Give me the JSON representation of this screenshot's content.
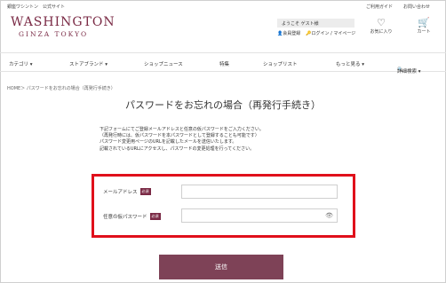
{
  "header": {
    "top_left": "銀座ワシントン　公式サイト",
    "top_links": [
      "ご利用ガイド",
      "お問い合わせ"
    ],
    "logo_line1": "WASHINGTON",
    "logo_line2": "GINZA TOKYO",
    "welcome": "ようこそ ゲスト様",
    "register": "会員登録",
    "login": "ログイン / マイページ",
    "favorite": "お気に入り",
    "cart": "カート"
  },
  "nav": {
    "items": [
      "カテゴリ ▾",
      "ストアブランド ▾",
      "ショップニュース",
      "特集",
      "ショップリスト",
      "もっと見る ▾",
      "詳細検索 ▾"
    ]
  },
  "breadcrumb": "HOME＞ パスワードをお忘れの場合（再発行手続き）",
  "page_title": "パスワードをお忘れの場合（再発行手続き）",
  "description": [
    "下記フォームにてご登録メールアドレスと任意の仮パスワードをご入力ください。",
    "（再発行時には、仮パスワードを本パスワードとして登録することも可能です）",
    "パスワード変更用ページのURLを記載したメールを送信いたします。",
    "記載されているURLにアクセスし、パスワードの変更処理を行ってください。"
  ],
  "form": {
    "email_label": "メールアドレス",
    "temp_password_label": "任意の仮パスワード",
    "required_badge": "必須",
    "email_value": "",
    "temp_password_value": ""
  },
  "submit_label": "送信",
  "colors": {
    "brand": "#7a2a45",
    "button": "#7e4257",
    "highlight": "#e0101b"
  }
}
